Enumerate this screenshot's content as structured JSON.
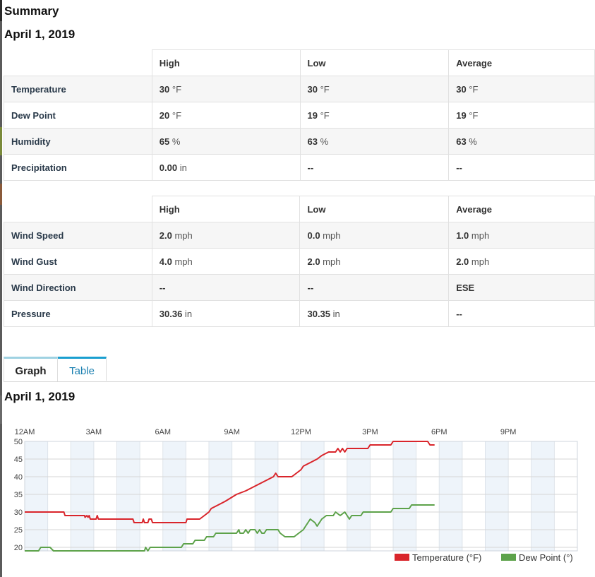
{
  "summary": {
    "heading": "Summary",
    "date": "April 1, 2019",
    "table1": {
      "headers": [
        "High",
        "Low",
        "Average"
      ],
      "rows": [
        {
          "label": "Temperature",
          "cells": [
            {
              "num": "30",
              "unit": " °F"
            },
            {
              "num": "30",
              "unit": " °F"
            },
            {
              "num": "30",
              "unit": " °F"
            }
          ]
        },
        {
          "label": "Dew Point",
          "cells": [
            {
              "num": "20",
              "unit": " °F"
            },
            {
              "num": "19",
              "unit": " °F"
            },
            {
              "num": "19",
              "unit": " °F"
            }
          ]
        },
        {
          "label": "Humidity",
          "cells": [
            {
              "num": "65",
              "unit": " %"
            },
            {
              "num": "63",
              "unit": " %"
            },
            {
              "num": "63",
              "unit": " %"
            }
          ]
        },
        {
          "label": "Precipitation",
          "cells": [
            {
              "num": "0.00",
              "unit": " in"
            },
            {
              "num": "--",
              "unit": ""
            },
            {
              "num": "--",
              "unit": ""
            }
          ]
        }
      ]
    },
    "table2": {
      "headers": [
        "High",
        "Low",
        "Average"
      ],
      "rows": [
        {
          "label": "Wind Speed",
          "cells": [
            {
              "num": "2.0",
              "unit": " mph"
            },
            {
              "num": "0.0",
              "unit": " mph"
            },
            {
              "num": "1.0",
              "unit": " mph"
            }
          ]
        },
        {
          "label": "Wind Gust",
          "cells": [
            {
              "num": "4.0",
              "unit": " mph"
            },
            {
              "num": "2.0",
              "unit": " mph"
            },
            {
              "num": "2.0",
              "unit": " mph"
            }
          ]
        },
        {
          "label": "Wind Direction",
          "cells": [
            {
              "num": "--",
              "unit": ""
            },
            {
              "num": "--",
              "unit": ""
            },
            {
              "num": "ESE",
              "unit": ""
            }
          ]
        },
        {
          "label": "Pressure",
          "cells": [
            {
              "num": "30.36",
              "unit": " in"
            },
            {
              "num": "30.35",
              "unit": " in"
            },
            {
              "num": "--",
              "unit": ""
            }
          ]
        }
      ]
    }
  },
  "tabs": {
    "graph": "Graph",
    "table": "Table",
    "active": "Graph"
  },
  "graph_date": "April 1, 2019",
  "colors": {
    "temperature": "#d9252b",
    "dew_point": "#5da24a",
    "band": "#eef4fa",
    "active_tab_top": "#9fd2e2",
    "tab_top": "#1a9fd0"
  },
  "chart_data": {
    "type": "line",
    "x_unit": "hour of day",
    "xlim": [
      0,
      24
    ],
    "ylim": [
      19,
      50
    ],
    "x_tick_labels": [
      "12AM",
      "3AM",
      "6AM",
      "9AM",
      "12PM",
      "3PM",
      "6PM",
      "9PM"
    ],
    "x_tick_hours": [
      0,
      3,
      6,
      9,
      12,
      15,
      18,
      21
    ],
    "y_ticks": [
      20,
      25,
      30,
      35,
      40,
      45,
      50
    ],
    "grid": true,
    "legend_position": "bottom-right",
    "series": [
      {
        "name": "Temperature (°F)",
        "points": [
          [
            0.0,
            30
          ],
          [
            1.7,
            30
          ],
          [
            1.75,
            29
          ],
          [
            2.6,
            29
          ],
          [
            2.62,
            28.5
          ],
          [
            2.7,
            29
          ],
          [
            2.75,
            28.5
          ],
          [
            2.8,
            29
          ],
          [
            2.85,
            28
          ],
          [
            3.1,
            28
          ],
          [
            3.15,
            29
          ],
          [
            3.2,
            28
          ],
          [
            4.7,
            28
          ],
          [
            4.75,
            27
          ],
          [
            5.1,
            27
          ],
          [
            5.15,
            28
          ],
          [
            5.2,
            27
          ],
          [
            5.35,
            27
          ],
          [
            5.4,
            28
          ],
          [
            5.5,
            28
          ],
          [
            5.55,
            27
          ],
          [
            7.0,
            27
          ],
          [
            7.05,
            28
          ],
          [
            7.6,
            28
          ],
          [
            7.8,
            29
          ],
          [
            8.0,
            30
          ],
          [
            8.1,
            31
          ],
          [
            8.4,
            32
          ],
          [
            8.7,
            33
          ],
          [
            8.95,
            34
          ],
          [
            9.2,
            35
          ],
          [
            9.6,
            36
          ],
          [
            9.9,
            37
          ],
          [
            10.2,
            38
          ],
          [
            10.5,
            39
          ],
          [
            10.8,
            40
          ],
          [
            10.9,
            41
          ],
          [
            11.0,
            40
          ],
          [
            11.6,
            40
          ],
          [
            11.8,
            41
          ],
          [
            12.0,
            42
          ],
          [
            12.1,
            43
          ],
          [
            12.4,
            44
          ],
          [
            12.7,
            45
          ],
          [
            12.9,
            46
          ],
          [
            13.2,
            47
          ],
          [
            13.5,
            47
          ],
          [
            13.6,
            48
          ],
          [
            13.7,
            47
          ],
          [
            13.8,
            48
          ],
          [
            13.9,
            47
          ],
          [
            14.0,
            48
          ],
          [
            14.9,
            48
          ],
          [
            15.0,
            49
          ],
          [
            15.9,
            49
          ],
          [
            16.0,
            50
          ],
          [
            17.5,
            50
          ],
          [
            17.6,
            49
          ],
          [
            17.8,
            49
          ]
        ]
      },
      {
        "name": "Dew Point (°)",
        "points": [
          [
            0.0,
            19
          ],
          [
            0.6,
            19
          ],
          [
            0.7,
            20
          ],
          [
            1.1,
            20
          ],
          [
            1.25,
            19
          ],
          [
            5.2,
            19
          ],
          [
            5.25,
            20
          ],
          [
            5.35,
            19
          ],
          [
            5.45,
            20
          ],
          [
            6.8,
            20
          ],
          [
            6.9,
            21
          ],
          [
            7.3,
            21
          ],
          [
            7.4,
            22
          ],
          [
            7.8,
            22
          ],
          [
            7.9,
            23
          ],
          [
            8.2,
            23
          ],
          [
            8.3,
            24
          ],
          [
            9.2,
            24
          ],
          [
            9.3,
            25
          ],
          [
            9.35,
            24
          ],
          [
            9.5,
            24
          ],
          [
            9.6,
            25
          ],
          [
            9.7,
            24
          ],
          [
            9.8,
            25
          ],
          [
            10.0,
            25
          ],
          [
            10.1,
            24
          ],
          [
            10.2,
            25
          ],
          [
            10.3,
            24
          ],
          [
            10.4,
            24
          ],
          [
            10.5,
            25
          ],
          [
            11.0,
            25
          ],
          [
            11.1,
            24
          ],
          [
            11.3,
            23
          ],
          [
            11.7,
            23
          ],
          [
            11.9,
            24
          ],
          [
            12.1,
            25
          ],
          [
            12.2,
            26
          ],
          [
            12.3,
            27
          ],
          [
            12.4,
            28
          ],
          [
            12.6,
            27
          ],
          [
            12.7,
            26
          ],
          [
            12.9,
            28
          ],
          [
            13.1,
            29
          ],
          [
            13.4,
            29
          ],
          [
            13.5,
            30
          ],
          [
            13.7,
            29
          ],
          [
            13.9,
            30
          ],
          [
            14.0,
            29
          ],
          [
            14.1,
            28
          ],
          [
            14.2,
            29
          ],
          [
            14.6,
            29
          ],
          [
            14.7,
            30
          ],
          [
            15.9,
            30
          ],
          [
            16.0,
            31
          ],
          [
            16.7,
            31
          ],
          [
            16.8,
            32
          ],
          [
            17.8,
            32
          ]
        ]
      }
    ]
  }
}
